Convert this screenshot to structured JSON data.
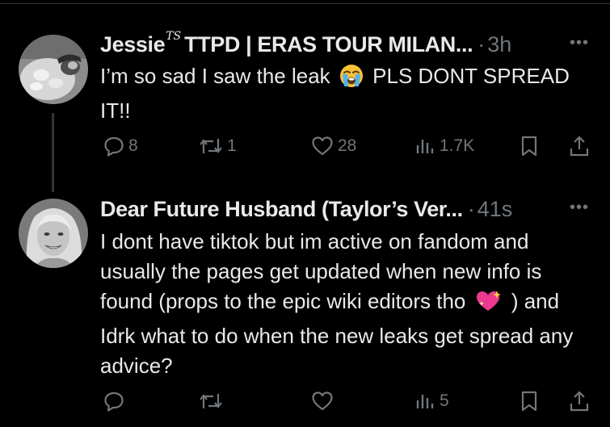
{
  "posts": [
    {
      "author": "Jessie",
      "author_badge": "TS",
      "author_suffix": "TTPD | ERAS TOUR MILAN...",
      "dot": "·",
      "time": "3h",
      "more": "•••",
      "text_1": "I’m so sad I saw the leak",
      "emoji": "loudly-crying-face",
      "text_2": "PLS DONT SPREAD IT!!",
      "replies": "8",
      "reposts": "1",
      "likes": "28",
      "views": "1.7K"
    },
    {
      "author": "Dear Future Husband (Taylor’s Ver...",
      "dot": "·",
      "time": "41s",
      "more": "•••",
      "text_1": "I dont have tiktok but im active on fandom and usually the pages get updated when new info is found (props to the epic wiki editors tho",
      "emoji": "sparkling-heart",
      "text_2": ") and Idrk what to do when the new leaks get spread any advice?",
      "replies": "",
      "reposts": "",
      "likes": "",
      "views": "5"
    }
  ],
  "colors": {
    "background": "#000000",
    "text": "#e7e9ea",
    "muted": "#71767b",
    "thread_line": "#333639"
  }
}
